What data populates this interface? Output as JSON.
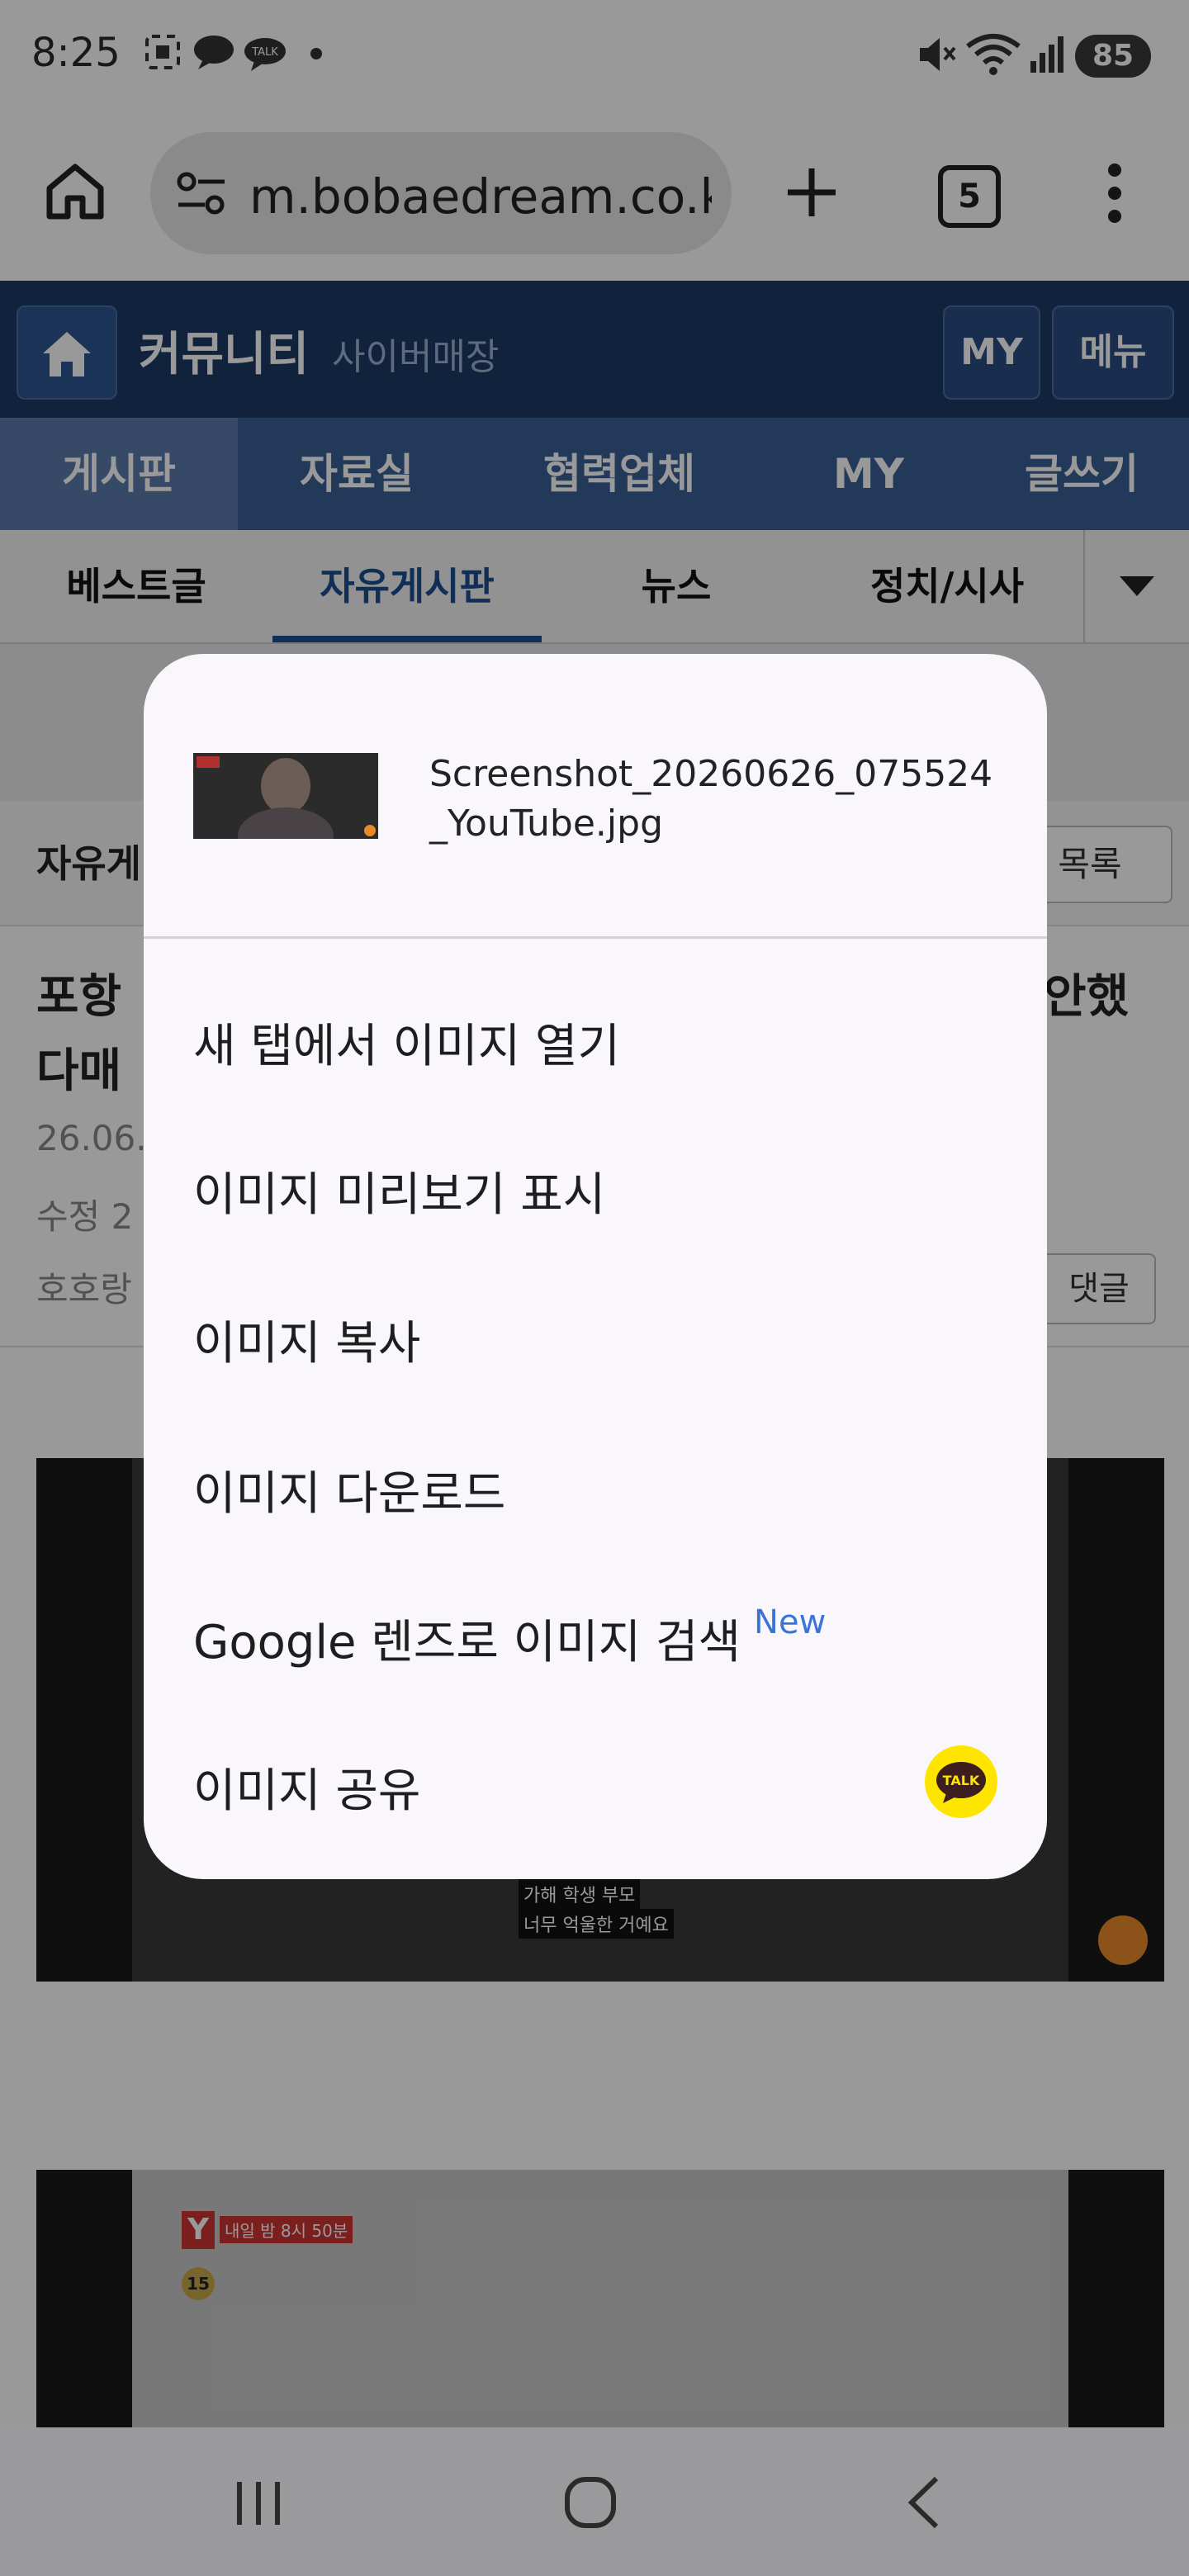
{
  "status_bar": {
    "time": "8:25",
    "battery": "85",
    "icons": [
      "screenshot-icon",
      "bubble-icon",
      "kakaotalk-icon",
      "dot-icon",
      "mute-icon",
      "wifi-icon",
      "signal-icon"
    ]
  },
  "browser": {
    "url": "m.bobaedream.co.kr",
    "tab_count": "5",
    "icons": [
      "home-icon",
      "site-settings-icon",
      "plus-icon",
      "tabs-icon",
      "more-vert-icon"
    ]
  },
  "site": {
    "title": "커뮤니티",
    "subtitle": "사이버매장",
    "my_button": "MY",
    "menu_button": "메뉴"
  },
  "nav": {
    "items": [
      "게시판",
      "자료실",
      "협력업체",
      "MY",
      "글쓰기"
    ]
  },
  "subnav": {
    "items": [
      "베스트글",
      "자유게시판",
      "뉴스",
      "정치/시사"
    ],
    "active_index": 1
  },
  "page": {
    "board_label": "자유게",
    "list_button": "목록",
    "post_title_line1": "포항",
    "post_title_line1_right": "안했",
    "post_title_line2": "다매",
    "date": "26.06.",
    "edited": "수정 2",
    "author": "호호랑",
    "comment_button": "댓글",
    "video1_caption_top": "가해 학생 부모",
    "video1_caption_bottom": "너무 억울한 거예요",
    "video2_label": "내일 밤 8시 50분",
    "video2_rating": "15"
  },
  "dialog": {
    "filename": "Screenshot_20260626_075524_YouTube.jpg",
    "items": [
      "새 탭에서 이미지 열기",
      "이미지 미리보기 표시",
      "이미지 복사",
      "이미지 다운로드",
      "Google 렌즈로 이미지 검색",
      "이미지 공유"
    ],
    "new_badge": "New",
    "talk_label": "TALK"
  },
  "colors": {
    "header": "#1d3a66",
    "nav": "#3a5f94",
    "active_sub": "#1d4f8f",
    "accent_new": "#3a74d8",
    "kakao": "#fee500"
  }
}
